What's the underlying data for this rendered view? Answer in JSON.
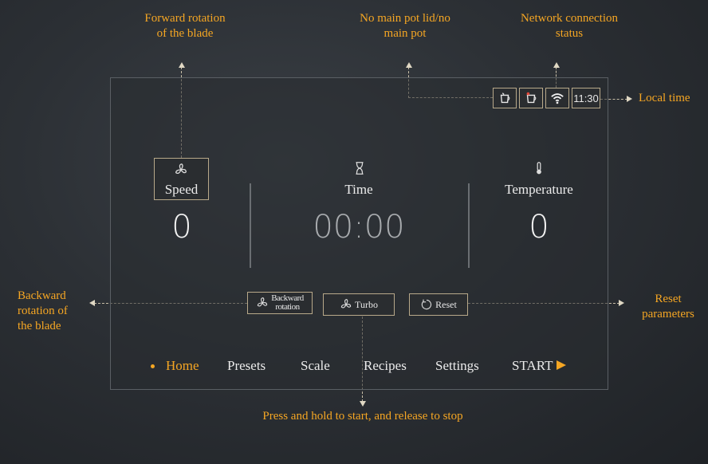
{
  "callouts": {
    "forward_rotation": "Forward rotation\nof the blade",
    "no_pot_lid": "No main pot lid/no\nmain pot",
    "network_status": "Network connection\nstatus",
    "local_time": "Local time",
    "backward_rotation": "Backward\nrotation of\nthe blade",
    "reset_parameters": "Reset\nparameters",
    "press_hold": "Press and hold to start, and release to stop"
  },
  "status_bar": {
    "lid_icon_1": "pot-lid-icon",
    "lid_icon_2": "pot-icon",
    "wifi_icon": "wifi-icon",
    "time": "11:30"
  },
  "columns": {
    "speed": {
      "label": "Speed",
      "value": "0",
      "icon": "fan-icon"
    },
    "time": {
      "label": "Time",
      "value": "00:00",
      "icon": "hourglass-icon"
    },
    "temperature": {
      "label": "Temperature",
      "value": "0",
      "icon": "thermometer-icon"
    }
  },
  "controls": {
    "backward_line1": "Backward",
    "backward_line2": "rotation",
    "turbo": "Turbo",
    "reset": "Reset"
  },
  "nav": {
    "home": "Home",
    "presets": "Presets",
    "scale": "Scale",
    "recipes": "Recipes",
    "settings": "Settings",
    "start": "START"
  },
  "colors": {
    "accent": "#f5a623",
    "background": "#2c3035",
    "box_border": "#b8a98a"
  }
}
